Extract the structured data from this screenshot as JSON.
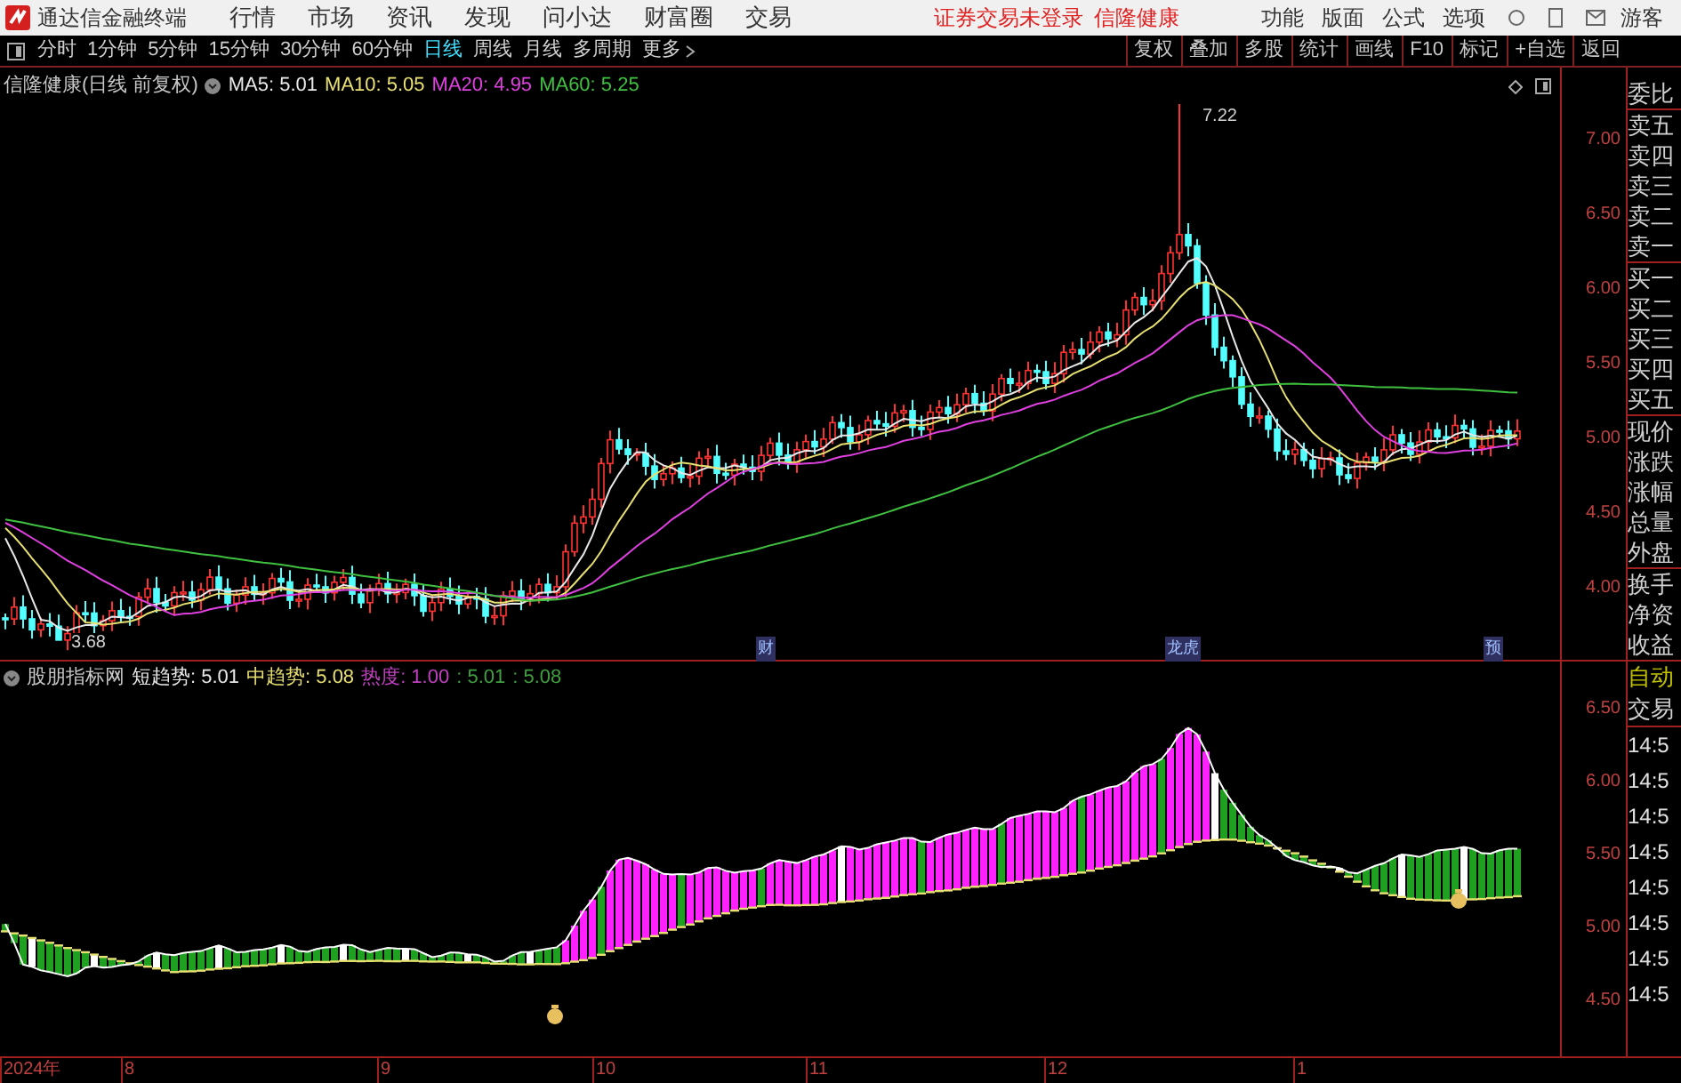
{
  "app_bar": {
    "app_name": "通达信金融终端",
    "menus": [
      "行情",
      "市场",
      "资讯",
      "发现",
      "问小达",
      "财富圈",
      "交易"
    ],
    "status_text": "证券交易未登录",
    "stock_name": "信隆健康",
    "right_menus": [
      "功能",
      "版面",
      "公式",
      "选项"
    ],
    "user": "游客"
  },
  "period_tabs": [
    {
      "label": "分时",
      "selected": false
    },
    {
      "label": "1分钟",
      "selected": false
    },
    {
      "label": "5分钟",
      "selected": false
    },
    {
      "label": "15分钟",
      "selected": false
    },
    {
      "label": "30分钟",
      "selected": false
    },
    {
      "label": "60分钟",
      "selected": false
    },
    {
      "label": "日线",
      "selected": true
    },
    {
      "label": "周线",
      "selected": false
    },
    {
      "label": "月线",
      "selected": false
    },
    {
      "label": "多周期",
      "selected": false
    },
    {
      "label": "更多",
      "selected": false
    }
  ],
  "toolbar_buttons": [
    "复权",
    "叠加",
    "多股",
    "统计",
    "画线",
    "F10",
    "标记",
    "+自选",
    "返回"
  ],
  "main_chart": {
    "title": "信隆健康(日线 前复权)",
    "indicators": [
      {
        "label": "MA5: 5.01",
        "color": "#e8e8e8"
      },
      {
        "label": "MA10: 5.05",
        "color": "#e8e070"
      },
      {
        "label": "MA20: 4.95",
        "color": "#e040e0"
      },
      {
        "label": "MA60: 5.25",
        "color": "#40c040"
      }
    ],
    "peak_label": "7.22",
    "low_label": "3.68",
    "y_axis_labels": [
      "7.00",
      "6.50",
      "6.00",
      "5.50",
      "5.00",
      "4.50",
      "4.00"
    ],
    "event_marks": [
      "财",
      "龙虎",
      "预"
    ]
  },
  "quote_panel": {
    "labels": [
      "委比",
      "卖五",
      "卖四",
      "卖三",
      "卖二",
      "卖一",
      "买一",
      "买二",
      "买三",
      "买四",
      "买五",
      "现价",
      "涨跌",
      "涨幅",
      "总量",
      "外盘",
      "换手",
      "净资",
      "收益"
    ]
  },
  "indicator_chart": {
    "name": "股朋指标网",
    "values": [
      {
        "label": "短趋势: 5.01",
        "color": "#e8e8e8"
      },
      {
        "label": "中趋势: 5.08",
        "color": "#e8e070"
      },
      {
        "label": "热度: 1.00",
        "color": "#c040c0"
      },
      {
        "label": ": 5.01",
        "color": "#40a040"
      },
      {
        "label": ": 5.08",
        "color": "#40a040"
      }
    ],
    "y_axis_labels": [
      "6.50",
      "6.00",
      "5.50",
      "5.00",
      "4.50"
    ]
  },
  "trade_panel": {
    "header": "自动",
    "subheader": "交易",
    "times": [
      "14:5",
      "14:5",
      "14:5",
      "14:5",
      "14:5",
      "14:5",
      "14:5",
      "14:5"
    ]
  },
  "date_axis": [
    "2024年",
    "8",
    "9",
    "10",
    "11",
    "12",
    "1"
  ]
}
